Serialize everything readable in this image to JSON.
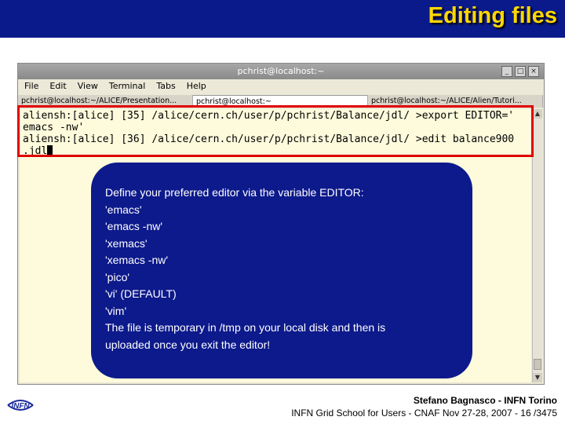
{
  "slide": {
    "title": "Editing files",
    "footer_author": "Stefano Bagnasco - INFN Torino",
    "footer_event": "INFN Grid School for Users - CNAF Nov 27-28, 2007 - 16 /3475",
    "logo_text": "INFN"
  },
  "window": {
    "title": "pchrist@localhost:~",
    "buttons": [
      "_",
      "□",
      "×"
    ]
  },
  "menu": [
    "File",
    "Edit",
    "View",
    "Terminal",
    "Tabs",
    "Help"
  ],
  "tabs": [
    {
      "label": "pchrist@localhost:~/ALICE/Presentation...",
      "active": false
    },
    {
      "label": "pchrist@localhost:~",
      "active": true
    },
    {
      "label": "pchrist@localhost:~/ALICE/Alien/Tutori...",
      "active": false
    }
  ],
  "terminal": {
    "lines": [
      "aliensh:[alice] [35] /alice/cern.ch/user/p/pchrist/Balance/jdl/ >export EDITOR='",
      "emacs -nw'",
      "aliensh:[alice] [36] /alice/cern.ch/user/p/pchrist/Balance/jdl/ >edit balance900",
      ".jdl"
    ]
  },
  "callout": {
    "lines": [
      "Define your preferred editor via the variable EDITOR:",
      "'emacs'",
      "'emacs -nw'",
      "'xemacs'",
      "'xemacs -nw'",
      "'pico'",
      "'vi' (DEFAULT)",
      "'vim'",
      "The file is temporary in /tmp on your local disk and then is",
      "uploaded once you exit the editor!"
    ]
  },
  "colors": {
    "header_bg": "#0a1a8a",
    "title": "#ffd700",
    "callout_bg": "#0d1a8c",
    "highlight": "#e00000",
    "terminal_bg": "#fdfbdc"
  },
  "icons": [
    "minimize-icon",
    "maximize-icon",
    "close-icon",
    "infn-logo"
  ]
}
